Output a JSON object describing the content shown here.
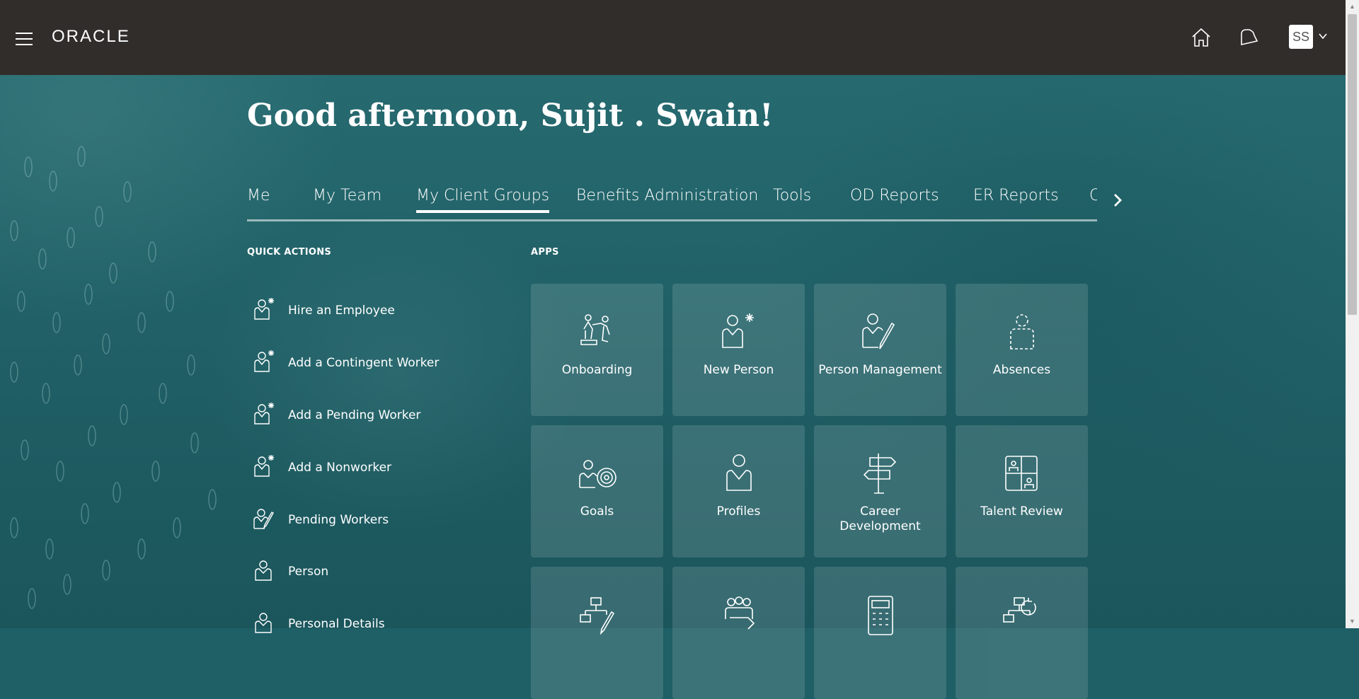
{
  "header": {
    "logo": "ORACLE",
    "avatar_initials": "SS"
  },
  "greeting": "Good afternoon, Sujit . Swain!",
  "tabs": [
    {
      "label": "Me"
    },
    {
      "label": "My Team"
    },
    {
      "label": "My Client Groups"
    },
    {
      "label": "Benefits Administration"
    },
    {
      "label": "Tools"
    },
    {
      "label": "OD Reports"
    },
    {
      "label": "ER Reports"
    },
    {
      "label": "C"
    }
  ],
  "active_tab": "My Client Groups",
  "quick_actions": {
    "title": "QUICK ACTIONS",
    "items": [
      {
        "label": "Hire an Employee",
        "icon": "person-add-icon"
      },
      {
        "label": "Add a Contingent Worker",
        "icon": "person-add-icon"
      },
      {
        "label": "Add a Pending Worker",
        "icon": "person-add-icon"
      },
      {
        "label": "Add a Nonworker",
        "icon": "person-add-icon"
      },
      {
        "label": "Pending Workers",
        "icon": "person-edit-icon"
      },
      {
        "label": "Person",
        "icon": "person-icon"
      },
      {
        "label": "Personal Details",
        "icon": "person-icon"
      }
    ]
  },
  "apps": {
    "title": "APPS",
    "tiles": [
      {
        "label": "Onboarding",
        "icon": "onboarding-icon"
      },
      {
        "label": "New Person",
        "icon": "new-person-icon"
      },
      {
        "label": "Person Management",
        "icon": "person-management-icon"
      },
      {
        "label": "Absences",
        "icon": "absences-icon"
      },
      {
        "label": "Goals",
        "icon": "goals-icon"
      },
      {
        "label": "Profiles",
        "icon": "profiles-icon"
      },
      {
        "label": "Career Development",
        "icon": "career-development-icon"
      },
      {
        "label": "Talent Review",
        "icon": "talent-review-icon"
      },
      {
        "label": "",
        "icon": "org-chart-edit-icon"
      },
      {
        "label": "",
        "icon": "team-icon"
      },
      {
        "label": "",
        "icon": "calculator-icon"
      },
      {
        "label": "",
        "icon": "org-chart-refresh-icon"
      }
    ]
  }
}
